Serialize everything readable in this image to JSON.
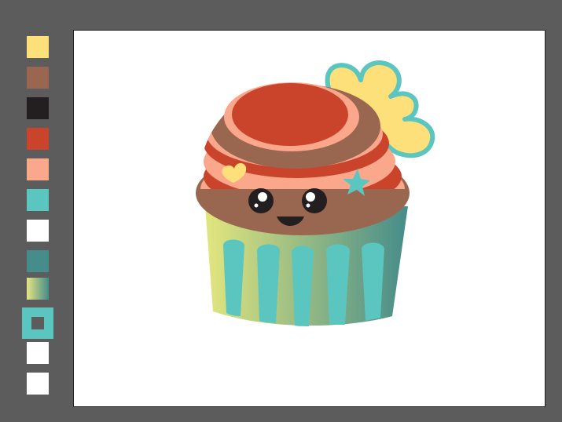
{
  "palette": {
    "swatches": [
      {
        "name": "yellow",
        "color": "#fde07a"
      },
      {
        "name": "brown",
        "color": "#996650"
      },
      {
        "name": "black",
        "color": "#231f20"
      },
      {
        "name": "red",
        "color": "#c9442b"
      },
      {
        "name": "salmon",
        "color": "#fba78c"
      },
      {
        "name": "teal",
        "color": "#5bc5c0"
      },
      {
        "name": "white",
        "color": "#ffffff"
      },
      {
        "name": "dark-teal",
        "color": "#468c8a"
      },
      {
        "name": "gradient",
        "color": "linear-gradient(90deg,#e6e582,#468c8a)"
      },
      {
        "name": "stroke-teal",
        "color": "#5bc5c0"
      },
      {
        "name": "white-2",
        "color": "#ffffff"
      },
      {
        "name": "white-3",
        "color": "#ffffff"
      }
    ]
  },
  "artwork": {
    "subject": "cupcake-illustration",
    "colors": {
      "wrapper_left": "#e3e67e",
      "wrapper_right": "#468c8a",
      "stripes": "#5bc5c0",
      "frosting_brown": "#996650",
      "frosting_salmon": "#fba78c",
      "frosting_red": "#c9442b",
      "flower_fill": "#fde07a",
      "flower_stroke": "#5bc5c0",
      "eye": "#231f20",
      "heart": "#fde07a",
      "star": "#5bc5c0"
    }
  }
}
